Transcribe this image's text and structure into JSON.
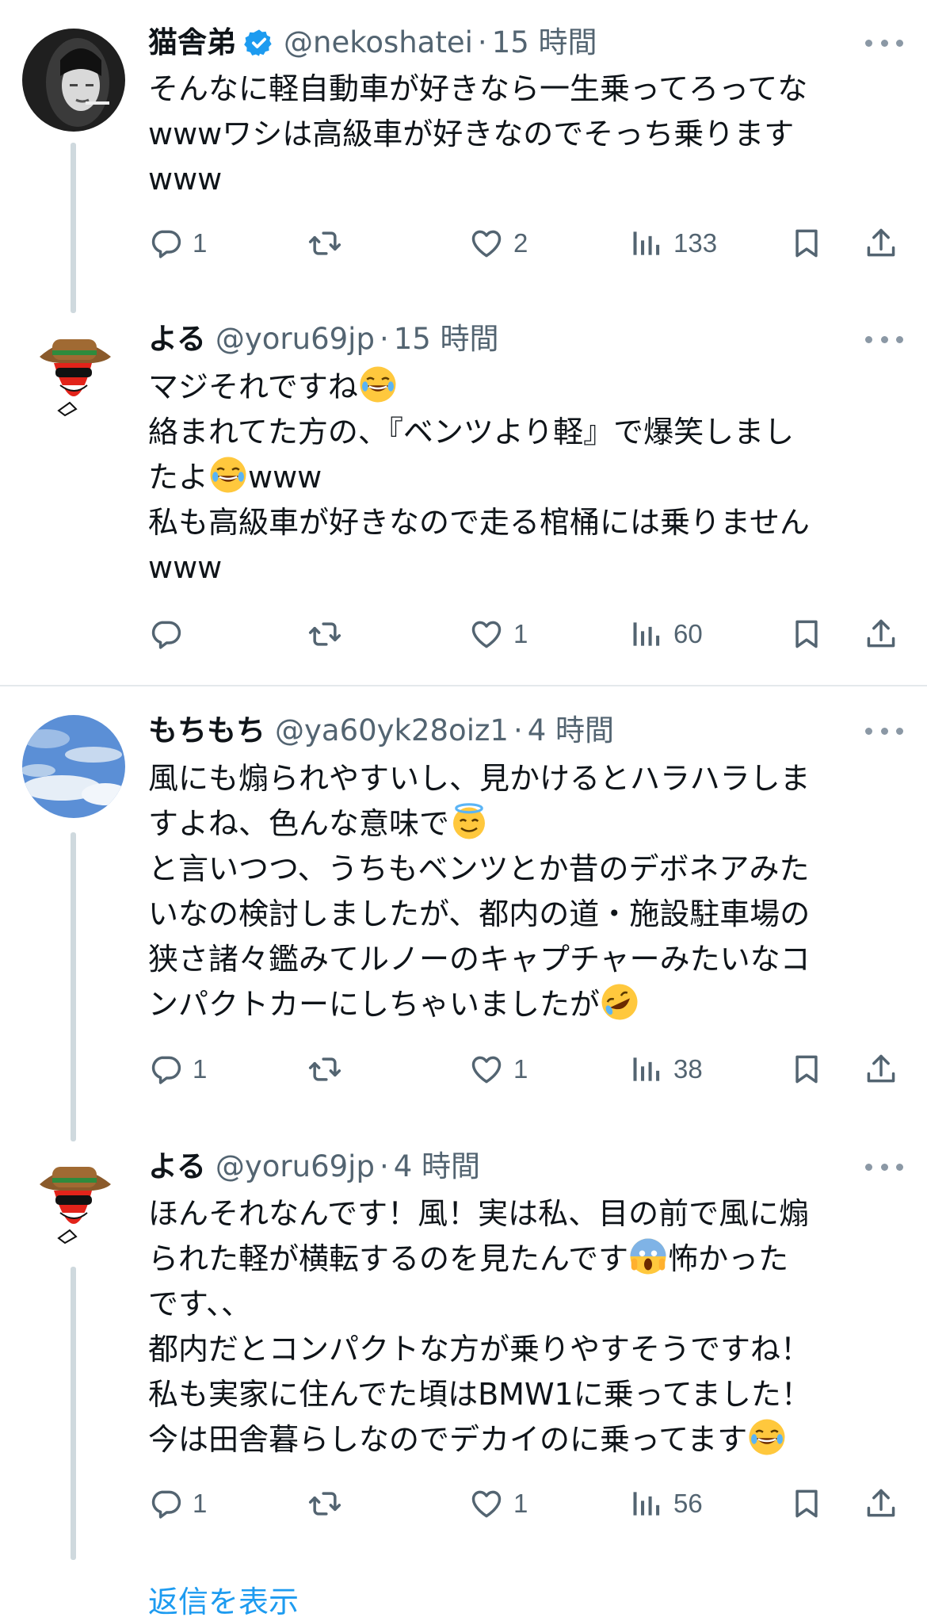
{
  "colors": {
    "text": "#0f1419",
    "muted": "#536471",
    "accent": "#1d9bf0",
    "line": "#cfd9de"
  },
  "tweets": [
    {
      "name": "猫舎弟",
      "verified": true,
      "handle": "@nekoshatei",
      "time": "15 時間",
      "lines": [
        "そんなに軽自動車が好きなら一生乗ってろってな",
        "wwwワシは高級車が好きなのでそっち乗ります",
        "www"
      ],
      "replies": "1",
      "retweets": "",
      "likes": "2",
      "views": "133"
    },
    {
      "name": "よる",
      "verified": false,
      "handle": "@yoru69jp",
      "time": "15 時間",
      "lines": [
        "マジそれですね",
        "絡まれてた方の、『ベンツより軽』で爆笑しまし",
        "たよ",
        "www",
        "私も高級車が好きなので走る棺桶には乗りません",
        "www"
      ],
      "replies": "",
      "retweets": "",
      "likes": "1",
      "views": "60"
    },
    {
      "name": "もちもち",
      "verified": false,
      "handle": "@ya60yk28oiz1",
      "time": "4 時間",
      "lines": [
        "風にも煽られやすいし、見かけるとハラハラしま",
        "すよね、色んな意味で",
        "と言いつつ、うちもベンツとか昔のデボネアみた",
        "いなの検討しましたが、都内の道・施設駐車場の",
        "狭さ諸々鑑みてルノーのキャプチャーみたいなコ",
        "ンパクトカーにしちゃいましたが"
      ],
      "replies": "1",
      "retweets": "",
      "likes": "1",
      "views": "38"
    },
    {
      "name": "よる",
      "verified": false,
      "handle": "@yoru69jp",
      "time": "4 時間",
      "lines": [
        "ほんそれなんです！風！実は私、目の前で風に煽",
        "られた軽が横転するのを見たんです",
        "怖かった",
        "です、、",
        "都内だとコンパクトな方が乗りやすそうですね！",
        "私も実家に住んでた頃はBMW1に乗ってました！",
        "今は田舎暮らしなのでデカイのに乗ってます"
      ],
      "replies": "1",
      "retweets": "",
      "likes": "1",
      "views": "56"
    }
  ],
  "icons": {
    "reply": "reply-icon",
    "retweet": "retweet-icon",
    "like": "heart-icon",
    "views": "views-icon",
    "bookmark": "bookmark-icon",
    "share": "share-icon"
  },
  "footer_link": "返信を表示"
}
